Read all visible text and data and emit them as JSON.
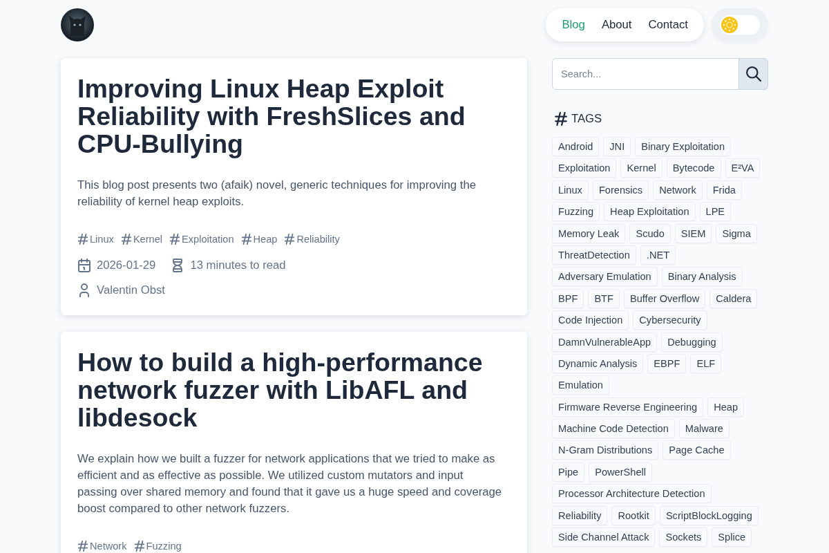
{
  "header": {
    "nav": [
      {
        "label": "Blog",
        "selected": true
      },
      {
        "label": "About",
        "selected": false
      },
      {
        "label": "Contact",
        "selected": false
      }
    ],
    "theme_toggle": {
      "dark": false
    }
  },
  "posts": [
    {
      "title": "Improving Linux Heap Exploit Reliability with FreshSlices and CPU-Bullying",
      "summary": "This blog post presents two (afaik) novel, generic techniques for improving the reliability of kernel heap exploits.",
      "tags": [
        "Linux",
        "Kernel",
        "Exploitation",
        "Heap",
        "Reliability"
      ],
      "date": "2026-01-29",
      "reading_time": "13 minutes to read",
      "author": "Valentin Obst"
    },
    {
      "title": "How to build a high-performance network fuzzer with LibAFL and libdesock",
      "summary": "We explain how we built a fuzzer for network applications that we tried to make as efficient and as effective as possible. We utilized custom mutators and input passing over shared memory and found that it gave us a huge speed and coverage boost compared to other network fuzzers.",
      "tags": [
        "Network",
        "Fuzzing"
      ]
    }
  ],
  "sidebar": {
    "search": {
      "placeholder": "Search..."
    },
    "tags_heading": "TAGS",
    "tags": [
      "Android",
      "JNI",
      "Binary Exploitation",
      "Exploitation",
      "Kernel",
      "Bytecode",
      "E²VA",
      "Linux",
      "Forensics",
      "Network",
      "Frida",
      "Fuzzing",
      "Heap Exploitation",
      "LPE",
      "Memory Leak",
      "Scudo",
      "SIEM",
      "Sigma",
      "ThreatDetection",
      ".NET",
      "Adversary Emulation",
      "Binary Analysis",
      "BPF",
      "BTF",
      "Buffer Overflow",
      "Caldera",
      "Code Injection",
      "Cybersecurity",
      "DamnVulnerableApp",
      "Debugging",
      "Dynamic Analysis",
      "EBPF",
      "ELF",
      "Emulation",
      "Firmware Reverse Engineering",
      "Heap",
      "Machine Code Detection",
      "Malware",
      "N-Gram Distributions",
      "Page Cache",
      "Pipe",
      "PowerShell",
      "Processor Architecture Detection",
      "Reliability",
      "Rootkit",
      "ScriptBlockLogging",
      "Side Channel Attack",
      "Sockets",
      "Splice"
    ]
  }
}
